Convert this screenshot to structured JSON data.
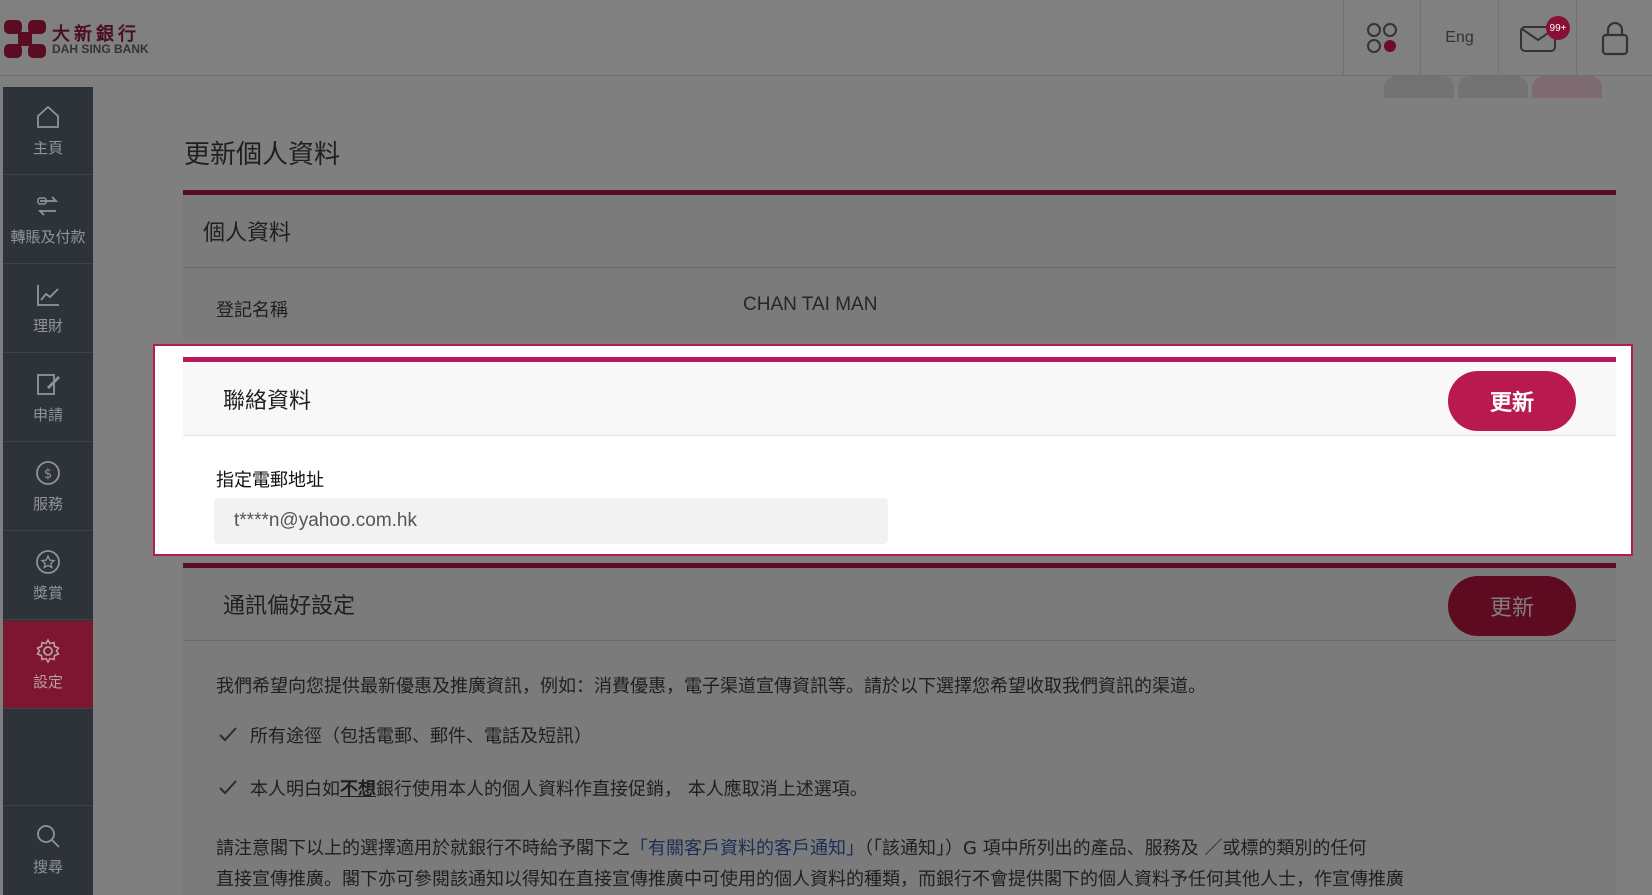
{
  "brand": {
    "name_cn": "大新銀行",
    "name_en": "DAH SING BANK",
    "color": "#b8194f"
  },
  "topbar": {
    "apps_icon": "apps-grid-icon",
    "language_label": "Eng",
    "mail_badge": "99+",
    "mail_icon": "mail-icon",
    "lock_icon": "lock-icon"
  },
  "sidebar": {
    "items": [
      {
        "label": "主頁",
        "icon": "home-icon"
      },
      {
        "label": "轉賬及付款",
        "icon": "transfer-icon"
      },
      {
        "label": "理財",
        "icon": "chart-icon"
      },
      {
        "label": "申請",
        "icon": "edit-icon"
      },
      {
        "label": "服務",
        "icon": "dollar-icon"
      },
      {
        "label": "獎賞",
        "icon": "star-icon"
      },
      {
        "label": "設定",
        "icon": "gear-icon",
        "active": true
      }
    ],
    "search_label": "搜尋"
  },
  "page": {
    "title": "更新個人資料"
  },
  "personal": {
    "header": "個人資料",
    "name_label": "登記名稱",
    "name_value": "CHAN TAI MAN"
  },
  "contact": {
    "header": "聯絡資料",
    "update_button": "更新",
    "email_label": "指定電郵地址",
    "email_value": "t****n@yahoo.com.hk"
  },
  "communication": {
    "header": "通訊偏好設定",
    "update_button": "更新",
    "intro": "我們希望向您提供最新優惠及推廣資訊，例如：消費優惠，電子渠道宣傳資訊等。請於以下選擇您希望收取我們資訊的渠道。",
    "option_all": "所有途徑（包括電郵、郵件、電話及短訊）",
    "option_optout_pre": "本人明白如",
    "option_optout_emph": "不想",
    "option_optout_post": "銀行使用本人的個人資料作直接促銷， 本人應取消上述選項。",
    "notice_pre": "請注意閣下以上的選擇適用於就銀行不時給予閣下之",
    "notice_link": "「有關客戶資料的客戶通知」",
    "notice_post": "（「該通知」）G 項中所列出的產品、服務及 ／或標的類別的任何",
    "notice_line2": "直接宣傳推廣。閣下亦可參閱該通知以得知在直接宣傳推廣中可使用的個人資料的種類，而銀行不會提供閣下的個人資料予任何其他人士，作宣傳推廣"
  }
}
